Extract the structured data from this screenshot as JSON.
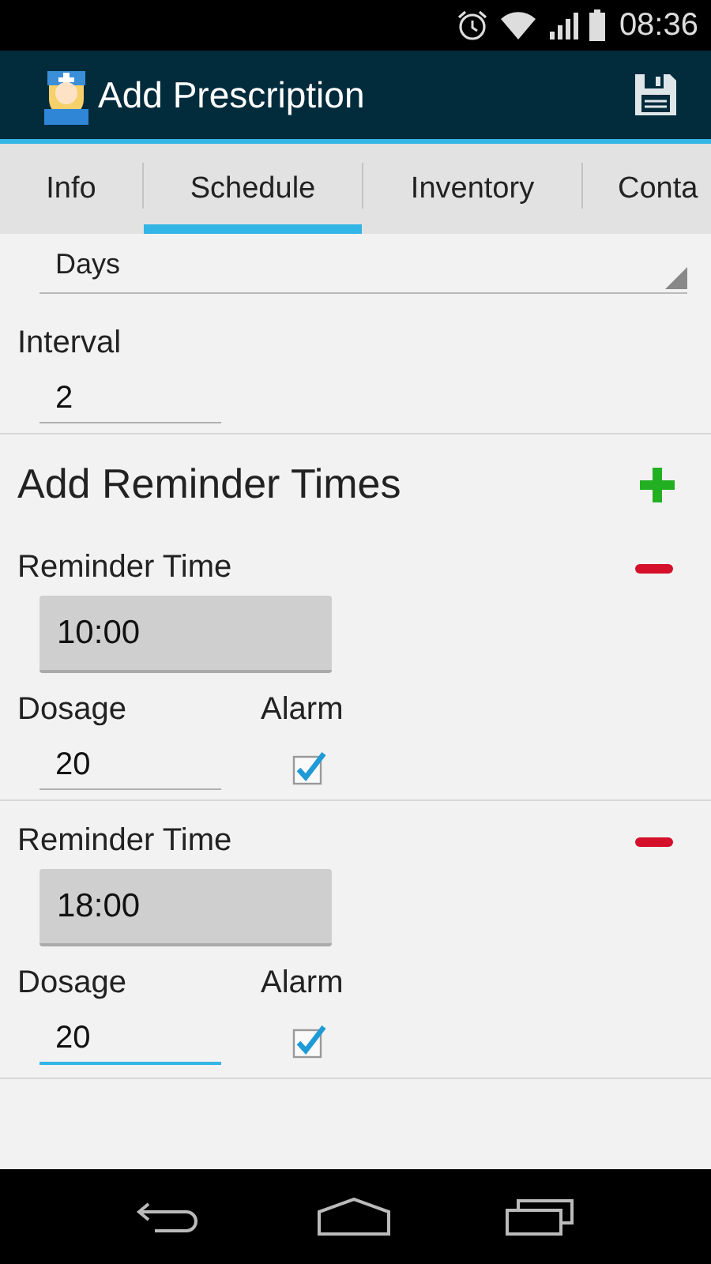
{
  "status_bar": {
    "time": "08:36"
  },
  "action_bar": {
    "title": "Add Prescription"
  },
  "tabs": [
    {
      "label": "Info",
      "selected": false
    },
    {
      "label": "Schedule",
      "selected": true
    },
    {
      "label": "Inventory",
      "selected": false
    },
    {
      "label": "Conta",
      "selected": false
    }
  ],
  "frequency": {
    "value": "Days"
  },
  "interval": {
    "label": "Interval",
    "value": "2",
    "focused": false
  },
  "reminders_header": {
    "title": "Add Reminder Times"
  },
  "reminders": [
    {
      "label": "Reminder Time",
      "time": "10:00",
      "dosage_label": "Dosage",
      "dosage": "20",
      "dosage_focused": false,
      "alarm_label": "Alarm",
      "alarm": true
    },
    {
      "label": "Reminder Time",
      "time": "18:00",
      "dosage_label": "Dosage",
      "dosage": "20",
      "dosage_focused": true,
      "alarm_label": "Alarm",
      "alarm": true
    }
  ]
}
